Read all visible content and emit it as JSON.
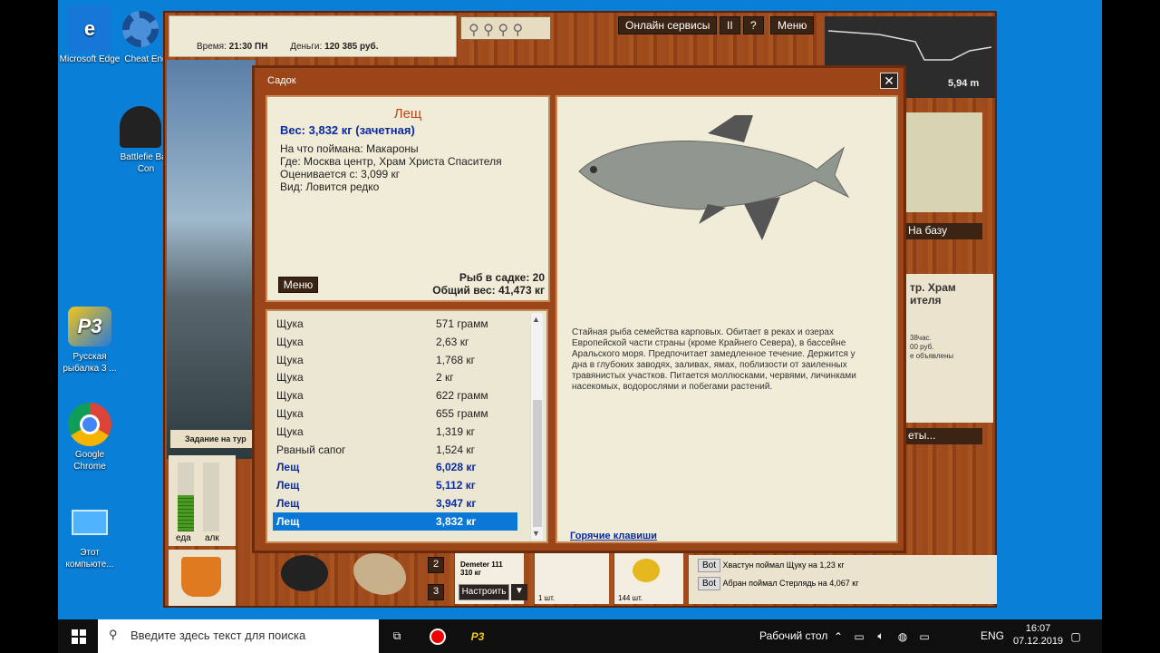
{
  "desktop": {
    "icons": [
      {
        "label": "Microsoft Edge"
      },
      {
        "label": "Cheat Eng"
      },
      {
        "label": "Battlefie Bad Con"
      },
      {
        "label": "Русская рыбалка 3 ..."
      },
      {
        "label": "Google Chrome"
      },
      {
        "label": "Этот компьюте..."
      }
    ]
  },
  "game": {
    "top": {
      "time_label": "Время:",
      "time_value": "21:30 ПН",
      "money_label": "Деньги:",
      "money_value": "120 385 руб."
    },
    "buttons": {
      "online": "Онлайн сервисы",
      "pause": "II",
      "help": "?",
      "menu": "Меню"
    },
    "map": {
      "distance": "5,94 m"
    },
    "to_base": "На базу",
    "location_partial": "тр. Храм ителя",
    "location_stats": [
      "38час.",
      "00 руб.",
      "е объявлены"
    ],
    "nets_btn": "еты...",
    "task_label": "Задание на тур",
    "gauges": {
      "food": "еда",
      "alc": "алк"
    },
    "bait": {
      "name": "Demeter 111",
      "size": "310 кг",
      "setup_btn": "Настроить",
      "count1": "1 шт.",
      "count2": "144 шт.",
      "slot2": "2",
      "slot3": "3"
    },
    "chat": [
      {
        "tag": "Bot",
        "text": "Хвастун поймал Щуку на 1,23 кг"
      },
      {
        "tag": "Bot",
        "text": "Абран поймал Стерлядь на 4,067 кг"
      }
    ]
  },
  "modal": {
    "title": "Садок",
    "fish": {
      "name": "Лещ",
      "weight": "Вес: 3,832 кг (зачетная)",
      "bait": "На что поймана: Макароны",
      "where": "Где: Москва центр, Храм Христа Спасителя",
      "price": "Оценивается с: 3,099 кг",
      "kind": "Вид: Ловится редко"
    },
    "menu_btn": "Меню",
    "count": "Рыб в садке: 20",
    "total": "Общий вес: 41,473 кг",
    "list": [
      {
        "name": "Щука",
        "weight": "571 грамм",
        "bold": false,
        "sel": false
      },
      {
        "name": "Щука",
        "weight": "2,63 кг",
        "bold": false,
        "sel": false
      },
      {
        "name": "Щука",
        "weight": "1,768 кг",
        "bold": false,
        "sel": false
      },
      {
        "name": "Щука",
        "weight": "2 кг",
        "bold": false,
        "sel": false
      },
      {
        "name": "Щука",
        "weight": "622 грамм",
        "bold": false,
        "sel": false
      },
      {
        "name": "Щука",
        "weight": "655 грамм",
        "bold": false,
        "sel": false
      },
      {
        "name": "Щука",
        "weight": "1,319 кг",
        "bold": false,
        "sel": false
      },
      {
        "name": "Рваный сапог",
        "weight": "1,524 кг",
        "bold": false,
        "sel": false
      },
      {
        "name": "Лещ",
        "weight": "6,028 кг",
        "bold": true,
        "sel": false
      },
      {
        "name": "Лещ",
        "weight": "5,112 кг",
        "bold": true,
        "sel": false
      },
      {
        "name": "Лещ",
        "weight": "3,947 кг",
        "bold": true,
        "sel": false
      },
      {
        "name": "Лещ",
        "weight": "3,832 кг",
        "bold": true,
        "sel": true
      }
    ],
    "description": "Стайная рыба семейства карповых. Обитает в реках и озерах Европейской части страны (кроме Крайнего Севера), в бассейне Аральского моря. Предпочитает замедленное течение. Держится у дна в глубоких заводях, заливах, ямах, поблизости от заиленных травянистых участков. Питается моллюсками, червями, личинками насекомых, водорослями и побегами растений.",
    "hotkeys": "Горячие клавиши"
  },
  "taskbar": {
    "search_placeholder": "Введите здесь текст для поиска",
    "desktop_label": "Рабочий стол",
    "lang": "ENG",
    "time": "16:07",
    "date": "07.12.2019"
  }
}
